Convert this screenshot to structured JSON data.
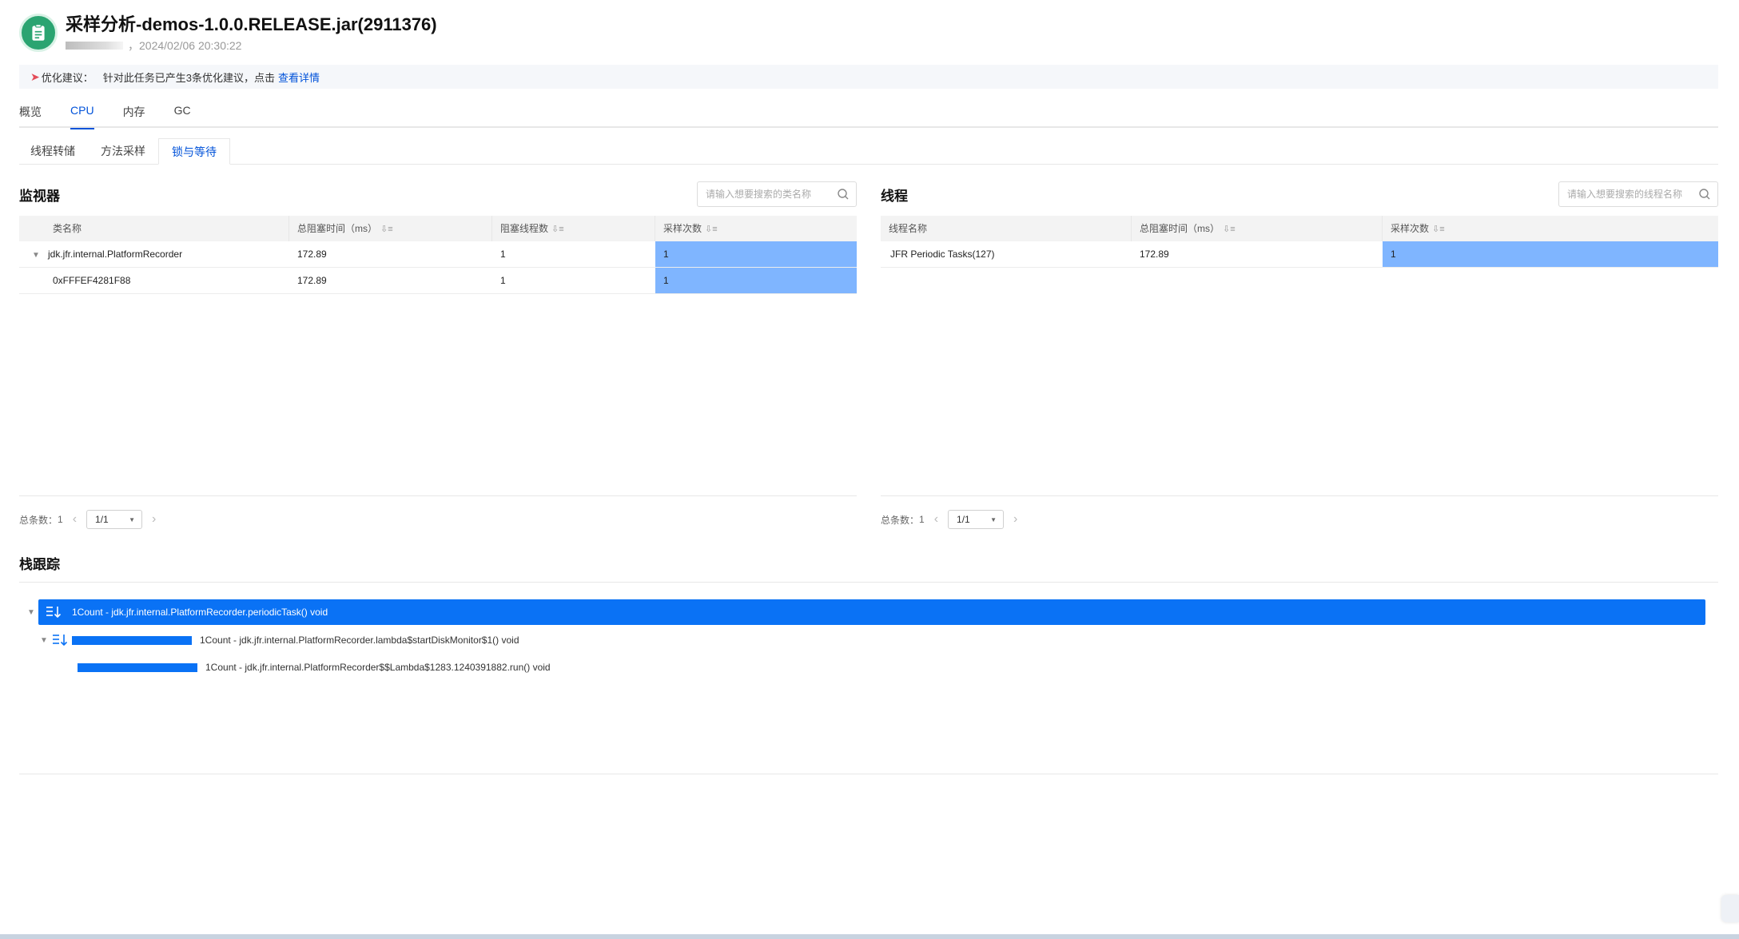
{
  "header": {
    "title": "采样分析-demos-1.0.0.RELEASE.jar(2911376)",
    "separator": "，",
    "timestamp": "2024/02/06 20:30:22"
  },
  "banner": {
    "label": "优化建议：",
    "text": "针对此任务已产生3条优化建议，点击",
    "link": "查看详情"
  },
  "main_tabs": [
    {
      "label": "概览",
      "active": false
    },
    {
      "label": "CPU",
      "active": true
    },
    {
      "label": "内存",
      "active": false
    },
    {
      "label": "GC",
      "active": false
    }
  ],
  "sub_tabs": [
    {
      "label": "线程转储",
      "active": false
    },
    {
      "label": "方法采样",
      "active": false
    },
    {
      "label": "锁与等待",
      "active": true
    }
  ],
  "monitor": {
    "title": "监视器",
    "search_placeholder": "请输入想要搜索的类名称",
    "columns": [
      "类名称",
      "总阻塞时间（ms）",
      "阻塞线程数",
      "采样次数"
    ],
    "rows": [
      {
        "name": "jdk.jfr.internal.PlatformRecorder",
        "time": "172.89",
        "threads": "1",
        "samples": "1"
      },
      {
        "name": "0xFFFEF4281F88",
        "time": "172.89",
        "threads": "1",
        "samples": "1"
      }
    ],
    "pager": {
      "total_label": "总条数：",
      "total": "1",
      "page": "1/1"
    }
  },
  "threads": {
    "title": "线程",
    "search_placeholder": "请输入想要搜索的线程名称",
    "columns": [
      "线程名称",
      "总阻塞时间（ms）",
      "采样次数"
    ],
    "rows": [
      {
        "name": "JFR Periodic Tasks(127)",
        "time": "172.89",
        "samples": "1"
      }
    ],
    "pager": {
      "total_label": "总条数：",
      "total": "1",
      "page": "1/1"
    }
  },
  "stack": {
    "title": "栈跟踪",
    "items": [
      {
        "label": "1Count - jdk.jfr.internal.PlatformRecorder.periodicTask() void",
        "selected": true
      },
      {
        "label": "1Count - jdk.jfr.internal.PlatformRecorder.lambda$startDiskMonitor$1() void",
        "selected": false
      },
      {
        "label": "1Count - jdk.jfr.internal.PlatformRecorder$$Lambda$1283.1240391882.run() void",
        "selected": false
      }
    ]
  },
  "colors": {
    "accent": "#0052d9",
    "highlight_cell": "#7fb5ff",
    "stack_bar": "#0a72f5",
    "logo": "#2ba471"
  },
  "icons": {
    "logo": "clipboard-icon",
    "banner": "rocket-icon",
    "search": "search-icon",
    "sort": "sort-icon",
    "expand": "caret-down-icon",
    "pager_prev": "chevron-left-icon",
    "pager_next": "chevron-right-icon"
  }
}
